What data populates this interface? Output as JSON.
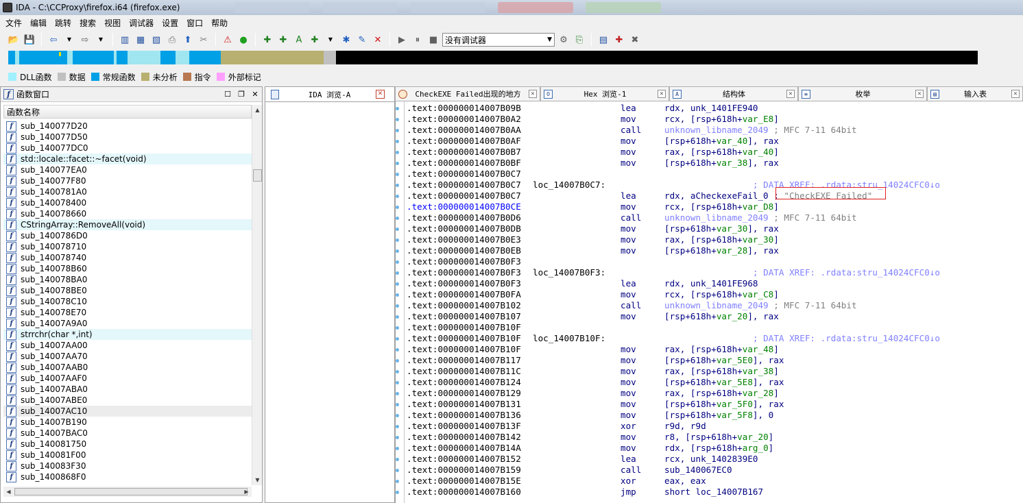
{
  "titlebar": {
    "title": "IDA - C:\\CCProxy\\firefox.i64 (firefox.exe)"
  },
  "menubar": [
    "文件",
    "编辑",
    "跳转",
    "搜索",
    "视图",
    "调试器",
    "设置",
    "窗口",
    "帮助"
  ],
  "toolbar": {
    "debugger_select": "没有调试器"
  },
  "navband": {
    "segments": [
      {
        "color": "#00a0e6",
        "w": 10
      },
      {
        "color": "#a0e6f0",
        "w": 6
      },
      {
        "color": "#00a0e6",
        "w": 70
      },
      {
        "color": "#a0e6f0",
        "w": 8
      },
      {
        "color": "#00a0e6",
        "w": 60
      },
      {
        "color": "#a0e6f0",
        "w": 4
      },
      {
        "color": "#00a0e6",
        "w": 16
      },
      {
        "color": "#a0e6f0",
        "w": 48
      },
      {
        "color": "#00a0e6",
        "w": 22
      },
      {
        "color": "#a0e6f0",
        "w": 20
      },
      {
        "color": "#00a0e6",
        "w": 46
      },
      {
        "color": "#b8b070",
        "w": 150
      },
      {
        "color": "#c0c0c0",
        "w": 18
      },
      {
        "color": "#000000",
        "w": 936
      }
    ]
  },
  "legend": [
    {
      "label": "DLL函数",
      "color": "#a0f0ff"
    },
    {
      "label": "数据",
      "color": "#c0c0c0"
    },
    {
      "label": "常规函数",
      "color": "#00a0e6"
    },
    {
      "label": "未分析",
      "color": "#b8b070"
    },
    {
      "label": "指令",
      "color": "#b87850"
    },
    {
      "label": "外部标记",
      "color": "#ffa0ff"
    }
  ],
  "functions_window": {
    "title": "函数窗口",
    "column_header": "函数名称",
    "items": [
      {
        "name": "sub_140077D20",
        "hl": ""
      },
      {
        "name": "sub_140077D50",
        "hl": ""
      },
      {
        "name": "sub_140077DC0",
        "hl": ""
      },
      {
        "name": "std::locale::facet::~facet(void)",
        "hl": "hl"
      },
      {
        "name": "sub_140077EA0",
        "hl": ""
      },
      {
        "name": "sub_140077F80",
        "hl": ""
      },
      {
        "name": "sub_1400781A0",
        "hl": ""
      },
      {
        "name": "sub_140078400",
        "hl": ""
      },
      {
        "name": "sub_140078660",
        "hl": ""
      },
      {
        "name": "CStringArray::RemoveAll(void)",
        "hl": "hl"
      },
      {
        "name": "sub_1400786D0",
        "hl": ""
      },
      {
        "name": "sub_140078710",
        "hl": ""
      },
      {
        "name": "sub_140078740",
        "hl": ""
      },
      {
        "name": "sub_140078B60",
        "hl": ""
      },
      {
        "name": "sub_140078BA0",
        "hl": ""
      },
      {
        "name": "sub_140078BE0",
        "hl": ""
      },
      {
        "name": "sub_140078C10",
        "hl": ""
      },
      {
        "name": "sub_140078E70",
        "hl": ""
      },
      {
        "name": "sub_14007A9A0",
        "hl": ""
      },
      {
        "name": "strrchr(char *,int)",
        "hl": "hl"
      },
      {
        "name": "sub_14007AA00",
        "hl": ""
      },
      {
        "name": "sub_14007AA70",
        "hl": ""
      },
      {
        "name": "sub_14007AAB0",
        "hl": ""
      },
      {
        "name": "sub_14007AAF0",
        "hl": ""
      },
      {
        "name": "sub_14007ABA0",
        "hl": ""
      },
      {
        "name": "sub_14007ABE0",
        "hl": ""
      },
      {
        "name": "sub_14007AC10",
        "hl": "sel"
      },
      {
        "name": "sub_14007B190",
        "hl": ""
      },
      {
        "name": "sub_14007BAC0",
        "hl": ""
      },
      {
        "name": "sub_140081750",
        "hl": ""
      },
      {
        "name": "sub_140081F00",
        "hl": ""
      },
      {
        "name": "sub_140083F30",
        "hl": ""
      },
      {
        "name": "sub_1400868F0",
        "hl": ""
      }
    ]
  },
  "ida_tab": {
    "label": "IDA 浏览-A",
    "close": "✕"
  },
  "tabs": [
    {
      "label": "CheckEXE Failed出现的地方",
      "w": 212,
      "round": true,
      "glyph": ""
    },
    {
      "label": "Hex 浏览-1",
      "w": 188,
      "round": false,
      "glyph": "O"
    },
    {
      "label": "结构体",
      "w": 188,
      "round": false,
      "glyph": "A"
    },
    {
      "label": "枚举",
      "w": 188,
      "round": false,
      "glyph": "≡"
    },
    {
      "label": "输入表",
      "w": 140,
      "round": false,
      "glyph": "▤"
    }
  ],
  "disasm": {
    "lines": [
      {
        "addr": ".text:000000014007B09B",
        "label": "",
        "mn": "lea",
        "op": [
          [
            "rdx, unk_1401FE940",
            ""
          ]
        ],
        "cmt": ""
      },
      {
        "addr": ".text:000000014007B0A2",
        "label": "",
        "mn": "mov",
        "op": [
          [
            "rcx, [rsp+618h+",
            ""
          ],
          [
            "var_E8",
            "v"
          ],
          [
            "]",
            ""
          ]
        ],
        "cmt": ""
      },
      {
        "addr": ".text:000000014007B0AA",
        "label": "",
        "mn": "call",
        "op": [
          [
            "unknown_libname_2049",
            "m"
          ],
          [
            " ; MFC 7-11 64bit",
            "s"
          ]
        ],
        "cmt": ""
      },
      {
        "addr": ".text:000000014007B0AF",
        "label": "",
        "mn": "mov",
        "op": [
          [
            "[rsp+618h+",
            ""
          ],
          [
            "var_40",
            "v"
          ],
          [
            "], rax",
            ""
          ]
        ],
        "cmt": ""
      },
      {
        "addr": ".text:000000014007B0B7",
        "label": "",
        "mn": "mov",
        "op": [
          [
            "rax, [rsp+618h+",
            ""
          ],
          [
            "var_40",
            "v"
          ],
          [
            "]",
            ""
          ]
        ],
        "cmt": ""
      },
      {
        "addr": ".text:000000014007B0BF",
        "label": "",
        "mn": "mov",
        "op": [
          [
            "[rsp+618h+",
            ""
          ],
          [
            "var_38",
            "v"
          ],
          [
            "], rax",
            ""
          ]
        ],
        "cmt": ""
      },
      {
        "addr": ".text:000000014007B0C7",
        "label": "",
        "mn": "",
        "op": [],
        "cmt": ""
      },
      {
        "addr": ".text:000000014007B0C7",
        "label": "loc_14007B0C7:",
        "mn": "",
        "op": [],
        "cmt": "; DATA XREF: .rdata:stru_14024CFC0↓o"
      },
      {
        "addr": ".text:000000014007B0C7",
        "label": "",
        "mn": "lea",
        "op": [
          [
            "rdx, aCheckexeFail_0 ; ",
            ""
          ],
          [
            "\"CheckEXE Failed\"",
            "g"
          ]
        ],
        "cmt": ""
      },
      {
        "addr": ".text:000000014007B0CE",
        "blue": true,
        "label": "",
        "mn": "mov",
        "op": [
          [
            "rcx, [rsp+618h+",
            ""
          ],
          [
            "var_D8",
            "v"
          ],
          [
            "]",
            ""
          ]
        ],
        "cmt": ""
      },
      {
        "addr": ".text:000000014007B0D6",
        "label": "",
        "mn": "call",
        "op": [
          [
            "unknown_libname_2049",
            "m"
          ],
          [
            " ; MFC 7-11 64bit",
            "s"
          ]
        ],
        "cmt": ""
      },
      {
        "addr": ".text:000000014007B0DB",
        "label": "",
        "mn": "mov",
        "op": [
          [
            "[rsp+618h+",
            ""
          ],
          [
            "var_30",
            "v"
          ],
          [
            "], rax",
            ""
          ]
        ],
        "cmt": ""
      },
      {
        "addr": ".text:000000014007B0E3",
        "label": "",
        "mn": "mov",
        "op": [
          [
            "rax, [rsp+618h+",
            ""
          ],
          [
            "var_30",
            "v"
          ],
          [
            "]",
            ""
          ]
        ],
        "cmt": ""
      },
      {
        "addr": ".text:000000014007B0EB",
        "label": "",
        "mn": "mov",
        "op": [
          [
            "[rsp+618h+",
            ""
          ],
          [
            "var_28",
            "v"
          ],
          [
            "], rax",
            ""
          ]
        ],
        "cmt": ""
      },
      {
        "addr": ".text:000000014007B0F3",
        "label": "",
        "mn": "",
        "op": [],
        "cmt": ""
      },
      {
        "addr": ".text:000000014007B0F3",
        "label": "loc_14007B0F3:",
        "mn": "",
        "op": [],
        "cmt": "; DATA XREF: .rdata:stru_14024CFC0↓o"
      },
      {
        "addr": ".text:000000014007B0F3",
        "label": "",
        "mn": "lea",
        "op": [
          [
            "rdx, unk_1401FE968",
            ""
          ]
        ],
        "cmt": ""
      },
      {
        "addr": ".text:000000014007B0FA",
        "label": "",
        "mn": "mov",
        "op": [
          [
            "rcx, [rsp+618h+",
            ""
          ],
          [
            "var_C8",
            "v"
          ],
          [
            "]",
            ""
          ]
        ],
        "cmt": ""
      },
      {
        "addr": ".text:000000014007B102",
        "label": "",
        "mn": "call",
        "op": [
          [
            "unknown_libname_2049",
            "m"
          ],
          [
            " ; MFC 7-11 64bit",
            "s"
          ]
        ],
        "cmt": ""
      },
      {
        "addr": ".text:000000014007B107",
        "label": "",
        "mn": "mov",
        "op": [
          [
            "[rsp+618h+",
            ""
          ],
          [
            "var_20",
            "v"
          ],
          [
            "], rax",
            ""
          ]
        ],
        "cmt": ""
      },
      {
        "addr": ".text:000000014007B10F",
        "label": "",
        "mn": "",
        "op": [],
        "cmt": ""
      },
      {
        "addr": ".text:000000014007B10F",
        "label": "loc_14007B10F:",
        "mn": "",
        "op": [],
        "cmt": "; DATA XREF: .rdata:stru_14024CFC0↓o"
      },
      {
        "addr": ".text:000000014007B10F",
        "label": "",
        "mn": "mov",
        "op": [
          [
            "rax, [rsp+618h+",
            ""
          ],
          [
            "var_48",
            "v"
          ],
          [
            "]",
            ""
          ]
        ],
        "cmt": ""
      },
      {
        "addr": ".text:000000014007B117",
        "label": "",
        "mn": "mov",
        "op": [
          [
            "[rsp+618h+",
            ""
          ],
          [
            "var_5E0",
            "v"
          ],
          [
            "], rax",
            ""
          ]
        ],
        "cmt": ""
      },
      {
        "addr": ".text:000000014007B11C",
        "label": "",
        "mn": "mov",
        "op": [
          [
            "rax, [rsp+618h+",
            ""
          ],
          [
            "var_38",
            "v"
          ],
          [
            "]",
            ""
          ]
        ],
        "cmt": ""
      },
      {
        "addr": ".text:000000014007B124",
        "label": "",
        "mn": "mov",
        "op": [
          [
            "[rsp+618h+",
            ""
          ],
          [
            "var_5E8",
            "v"
          ],
          [
            "], rax",
            ""
          ]
        ],
        "cmt": ""
      },
      {
        "addr": ".text:000000014007B129",
        "label": "",
        "mn": "mov",
        "op": [
          [
            "rax, [rsp+618h+",
            ""
          ],
          [
            "var_28",
            "v"
          ],
          [
            "]",
            ""
          ]
        ],
        "cmt": ""
      },
      {
        "addr": ".text:000000014007B131",
        "label": "",
        "mn": "mov",
        "op": [
          [
            "[rsp+618h+",
            ""
          ],
          [
            "var_5F0",
            "v"
          ],
          [
            "], rax",
            ""
          ]
        ],
        "cmt": ""
      },
      {
        "addr": ".text:000000014007B136",
        "label": "",
        "mn": "mov",
        "op": [
          [
            "[rsp+618h+",
            ""
          ],
          [
            "var_5F8",
            "v"
          ],
          [
            "], 0",
            ""
          ]
        ],
        "cmt": ""
      },
      {
        "addr": ".text:000000014007B13F",
        "label": "",
        "mn": "xor",
        "op": [
          [
            "r9d, r9d",
            ""
          ]
        ],
        "cmt": ""
      },
      {
        "addr": ".text:000000014007B142",
        "label": "",
        "mn": "mov",
        "op": [
          [
            "r8, [rsp+618h+",
            ""
          ],
          [
            "var_20",
            "v"
          ],
          [
            "]",
            ""
          ]
        ],
        "cmt": ""
      },
      {
        "addr": ".text:000000014007B14A",
        "label": "",
        "mn": "mov",
        "op": [
          [
            "rdx, [rsp+618h+",
            ""
          ],
          [
            "arg_0",
            "v"
          ],
          [
            "]",
            ""
          ]
        ],
        "cmt": ""
      },
      {
        "addr": ".text:000000014007B152",
        "label": "",
        "mn": "lea",
        "op": [
          [
            "rcx, unk_1402839E0",
            ""
          ]
        ],
        "cmt": ""
      },
      {
        "addr": ".text:000000014007B159",
        "label": "",
        "mn": "call",
        "op": [
          [
            "sub_140067EC0",
            ""
          ]
        ],
        "cmt": ""
      },
      {
        "addr": ".text:000000014007B15E",
        "label": "",
        "mn": "xor",
        "op": [
          [
            "eax, eax",
            ""
          ]
        ],
        "cmt": ""
      },
      {
        "addr": ".text:000000014007B160",
        "label": "",
        "mn": "jmp",
        "op": [
          [
            "short loc_14007B167",
            ""
          ]
        ],
        "cmt": ""
      }
    ]
  }
}
